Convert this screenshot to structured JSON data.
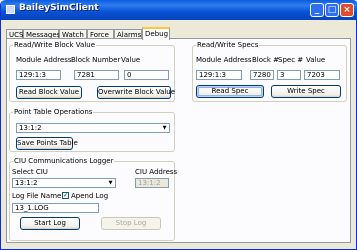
{
  "window": {
    "title": "BaileySimClient"
  },
  "tabs": [
    "UCS",
    "Messages",
    "Watch",
    "Force",
    "Alarms",
    "Debug"
  ],
  "active_tab": "Debug",
  "read_write_block": {
    "legend": "Read/Write Block Value",
    "module_address_label": "Module Address",
    "block_number_label": "Block Number",
    "value_label": "Value",
    "module_address_value": "129:1:3",
    "block_number_value": "7281",
    "value_value": "0",
    "read_button": "Read Block Value",
    "overwrite_button": "Overwrite Block Value"
  },
  "read_write_specs": {
    "legend": "Read/Write Specs",
    "module_address_label": "Module Address",
    "block_label": "Block #",
    "spec_label": "Spec #",
    "value_label": "Value",
    "module_address_value": "129:1:3",
    "block_value": "7280",
    "spec_value": "3",
    "value_value": "7203",
    "read_button": "Read Spec",
    "write_button": "Write Spec"
  },
  "point_table": {
    "legend": "Point Table Operations",
    "selected": "13:1:2",
    "save_button": "Save Points Table"
  },
  "ciu_logger": {
    "legend": "CIU Communications Logger",
    "select_ciu_label": "Select CIU",
    "select_ciu_value": "13:1:2",
    "ciu_address_label": "CIU Address",
    "ciu_address_value": "13:1:2",
    "log_file_label": "Log File Name",
    "append_log_label": "Apend Log",
    "log_file_value": "13_1.LOG",
    "start_button": "Start Log",
    "stop_button": "Stop Log"
  }
}
